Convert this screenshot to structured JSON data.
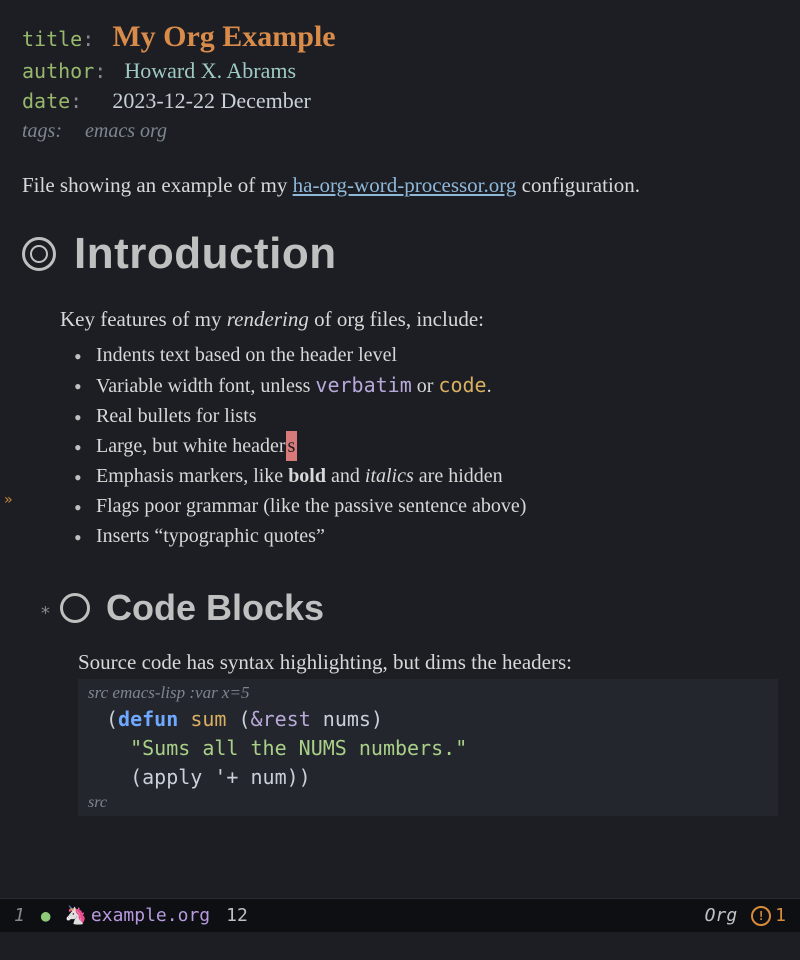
{
  "meta": {
    "title_key": "title",
    "title_val": "My Org Example",
    "author_key": "author",
    "author_val": "Howard X. Abrams",
    "date_key": "date",
    "date_val": "2023-12-22 December",
    "tags_key": "tags:",
    "tags_val": "emacs org"
  },
  "intro": {
    "before_link": "File showing an example of my ",
    "link_text": "ha-org-word-processor.org",
    "after_link": " configuration."
  },
  "h1": "Introduction",
  "para1": {
    "a": "Key features of my ",
    "b": "rendering",
    "c": " of org files, include:"
  },
  "bullets": {
    "b1": "Indents text based on the header level",
    "b2a": "Variable width font, unless ",
    "b2_verbatim": "verbatim",
    "b2b": " or ",
    "b2_code": "code",
    "b2c": ".",
    "b3": "Real bullets for lists",
    "b4a": "Large, but white header",
    "b4_cursor": "s",
    "b5a": "Emphasis markers, like ",
    "b5_bold": "bold",
    "b5b": " and ",
    "b5_ital": "italics",
    "b5c": " are hidden",
    "b6": "Flags poor grammar (like the passive sentence above)",
    "b7": "Inserts “typographic quotes”"
  },
  "h2_star": "*",
  "h2": "Code Blocks",
  "src_para": "Source code has syntax highlighting, but dims the headers:",
  "src": {
    "header_prefix": "src ",
    "header_lang": "emacs-lisp :var x=5",
    "line1_open": "(",
    "line1_defun": "defun",
    "line1_sp1": " ",
    "line1_name": "sum",
    "line1_sp2": " (",
    "line1_rest": "&rest",
    "line1_sp3": " ",
    "line1_arg": "nums",
    "line1_close": ")",
    "line2_doc": "  \"Sums all the NUMS numbers.\"",
    "line3": "  (apply '+ num))",
    "footer": "src"
  },
  "fringe": "»",
  "modeline": {
    "winnum": "1",
    "dot": "●",
    "unicorn": "🦄",
    "filename": "example.org",
    "linenum": "12",
    "mode": "Org",
    "warn_icon": "!",
    "warn_count": "1"
  }
}
